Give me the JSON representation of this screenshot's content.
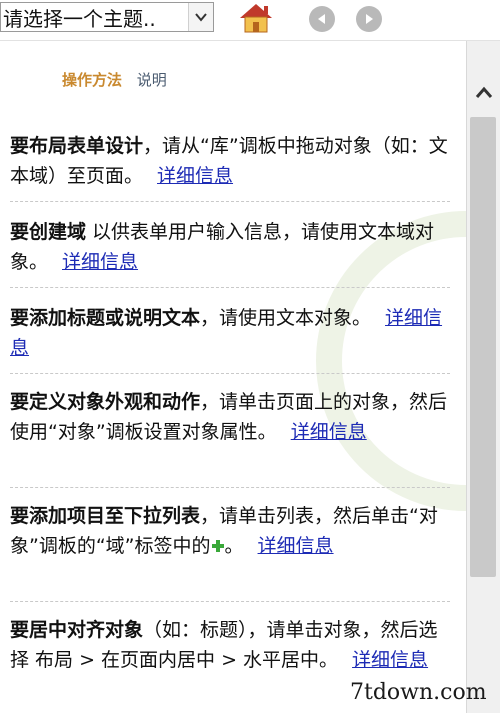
{
  "toolbar": {
    "select_value": "请选择一个主题..",
    "home_icon": "home-icon",
    "back_icon": "arrow-left-icon",
    "forward_icon": "arrow-right-icon"
  },
  "header": {
    "tab_howto": "操作方法",
    "tab_desc": "说明"
  },
  "items": [
    {
      "bold": "要布局表单设计",
      "text": "，请从“库”调板中拖动对象（如：文本域）至页面。",
      "link": "详细信息"
    },
    {
      "bold": "要创建域",
      "text": " 以供表单用户输入信息，请使用文本域对象。",
      "link": "详细信息"
    },
    {
      "bold": "要添加标题或说明文本",
      "text": "，请使用文本对象。",
      "link": "详细信息"
    },
    {
      "bold": "要定义对象外观和动作",
      "text": "，请单击页面上的对象，然后使用“对象”调板设置对象属性。",
      "link": "详细信息"
    },
    {
      "bold": "要添加项目至下拉列表",
      "text": "，请单击列表，然后单击“对象”调板的“域”标签中的",
      "text2": "。",
      "link": "详细信息"
    },
    {
      "bold": "要居中对齐对象",
      "text": "（如：标题），请单击对象，然后选择 布局 > 在页面内居中 > 水平居中。",
      "link": "详细信息"
    }
  ],
  "watermark": "7tdown.com",
  "colors": {
    "accent_orange": "#c9892f",
    "link_blue": "#1d2bb5",
    "home_roof": "#c0392b",
    "home_body": "#f2c14e"
  }
}
